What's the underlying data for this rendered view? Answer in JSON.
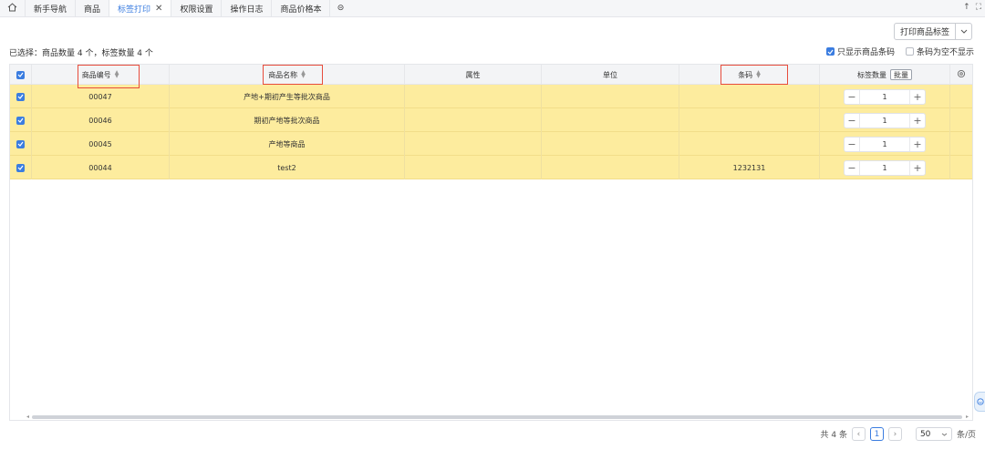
{
  "tabs": [
    {
      "label": "新手导航",
      "active": false
    },
    {
      "label": "商品",
      "active": false
    },
    {
      "label": "标签打印",
      "active": true,
      "closable": true
    },
    {
      "label": "权限设置",
      "active": false
    },
    {
      "label": "操作日志",
      "active": false
    },
    {
      "label": "商品价格本",
      "active": false
    }
  ],
  "tab_close_glyph": "✕",
  "tab_more_glyph": "⊝",
  "window_controls": {
    "up": "↑",
    "expand": "⛶"
  },
  "toolbar": {
    "print_label": "打印商品标签"
  },
  "summary": "已选择：商品数量 4 个，标签数量 4 个",
  "options": {
    "only_barcode": {
      "label": "只显示商品条码",
      "checked": true
    },
    "hide_empty_barcode": {
      "label": "条码为空不显示",
      "checked": false
    }
  },
  "columns": {
    "code": "商品编号",
    "name": "商品名称",
    "attr": "属性",
    "unit": "单位",
    "barcode": "条码",
    "label_qty": "标签数量",
    "batch": "批量"
  },
  "rows": [
    {
      "code": "00047",
      "name": "产地+期初产生等批次商品",
      "attr": "",
      "unit": "",
      "barcode": "",
      "qty": "1"
    },
    {
      "code": "00046",
      "name": "期初产地等批次商品",
      "attr": "",
      "unit": "",
      "barcode": "",
      "qty": "1"
    },
    {
      "code": "00045",
      "name": "产地等商品",
      "attr": "",
      "unit": "",
      "barcode": "",
      "qty": "1"
    },
    {
      "code": "00044",
      "name": "test2",
      "attr": "",
      "unit": "",
      "barcode": "1232131",
      "qty": "1"
    }
  ],
  "stepper": {
    "minus": "−",
    "plus": "+"
  },
  "pagination": {
    "total": "共 4 条",
    "prev": "‹",
    "page": "1",
    "next": "›",
    "page_size": "50",
    "unit": "条/页"
  },
  "colors": {
    "accent": "#3b7de0",
    "selected_row": "#fdec9e",
    "highlight_box": "#e74c3c"
  }
}
